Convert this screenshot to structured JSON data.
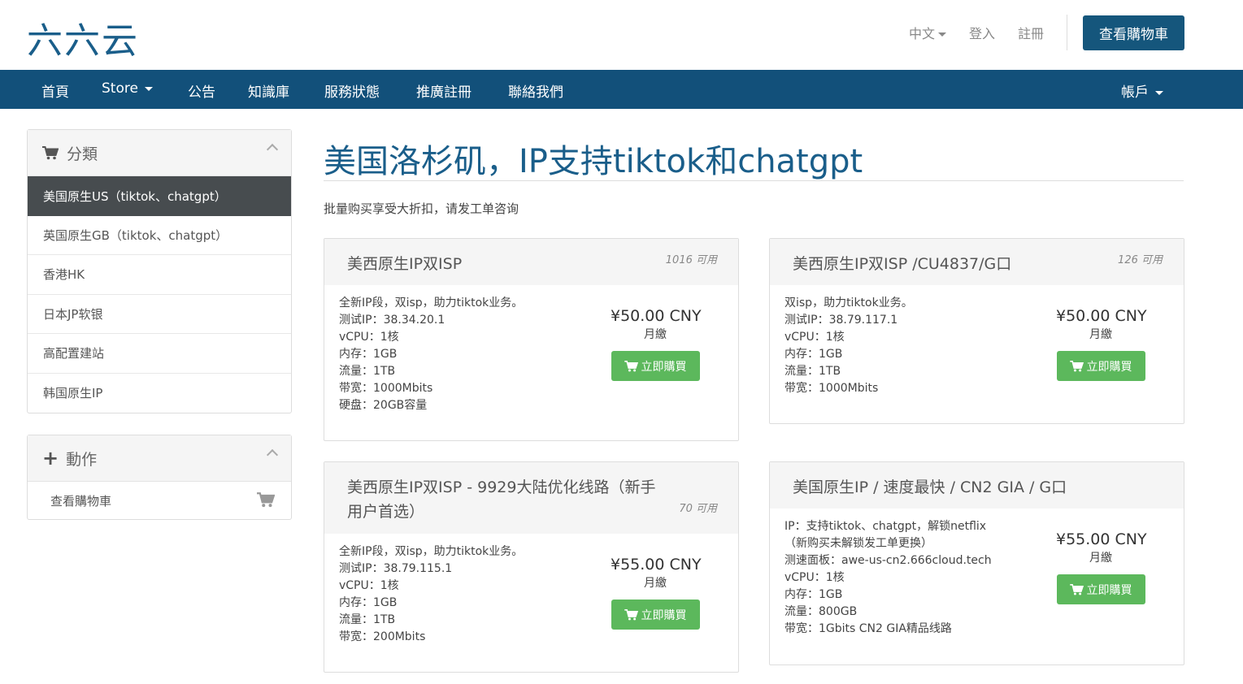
{
  "header": {
    "logo": "六六云",
    "language": "中文",
    "login": "登入",
    "register": "註冊",
    "view_cart": "查看購物車"
  },
  "nav": {
    "items": [
      "首頁",
      "Store",
      "公告",
      "知識庫",
      "服務狀態",
      "推廣註冊",
      "聯絡我們"
    ],
    "account": "帳戶"
  },
  "sidebar": {
    "categories_title": "分類",
    "categories": [
      "美国原生US（tiktok、chatgpt）",
      "英国原生GB（tiktok、chatgpt）",
      "香港HK",
      "日本JP软银",
      "高配置建站",
      "韩国原生IP"
    ],
    "active_index": 0,
    "actions_title": "動作",
    "actions": [
      "查看購物車"
    ]
  },
  "main": {
    "title": "美国洛杉矶，IP支持tiktok和chatgpt",
    "tagline": "批量购买享受大折扣，请发工单咨询",
    "order_label": "立即購買",
    "products": [
      {
        "name": "美西原生IP双ISP",
        "availability": "1016 可用",
        "description": [
          "全新IP段，双isp，助力tiktok业务。",
          "测试IP：38.34.20.1",
          "vCPU：1核",
          "内存：1GB",
          "流量：1TB",
          "带宽：1000Mbits",
          "硬盘：20GB容量"
        ],
        "price": "¥50.00 CNY",
        "cycle": "月繳"
      },
      {
        "name": "美西原生IP双ISP /CU4837/G口",
        "availability": "126 可用",
        "description": [
          "双isp，助力tiktok业务。",
          "测试IP：38.79.117.1",
          "vCPU：1核",
          "内存：1GB",
          "流量：1TB",
          "带宽：1000Mbits"
        ],
        "price": "¥50.00 CNY",
        "cycle": "月繳"
      },
      {
        "name": "美西原生IP双ISP - 9929大陆优化线路（新手用户首选）",
        "availability": "70 可用",
        "description": [
          "全新IP段，双isp，助力tiktok业务。",
          "测试IP：38.79.115.1",
          "vCPU：1核",
          "内存：1GB",
          "流量：1TB",
          "带宽：200Mbits"
        ],
        "price": "¥55.00 CNY",
        "cycle": "月繳"
      },
      {
        "name": "美国原生IP / 速度最快 / CN2 GIA / G口",
        "availability": "",
        "description": [
          "IP：支持tiktok、chatgpt，解锁netflix",
          "（新购买未解锁发工单更换）",
          "测速面板：awe-us-cn2.666cloud.tech",
          "vCPU：1核",
          "内存：1GB",
          "流量：800GB",
          "带宽：1Gbits CN2 GIA精品线路"
        ],
        "price": "¥55.00 CNY",
        "cycle": "月繳"
      }
    ]
  },
  "colors": {
    "brand": "#12507a",
    "order_button": "#5cb85c",
    "active_category": "#474c4f"
  }
}
